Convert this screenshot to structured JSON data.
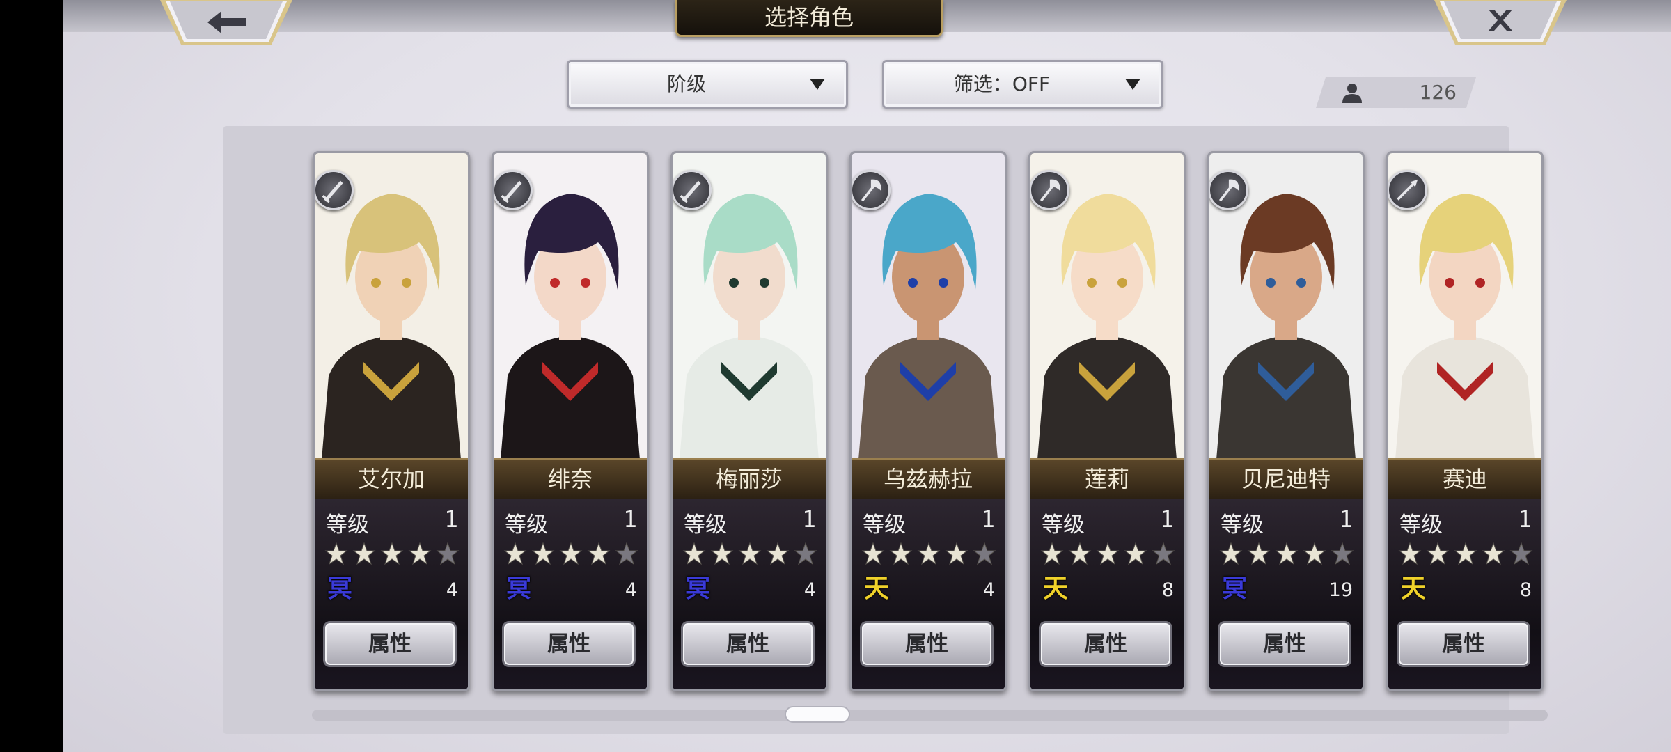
{
  "header": {
    "title": "选择角色",
    "back_icon": "arrow-left-icon",
    "close_icon": "close-icon"
  },
  "filters": {
    "sort_label": "阶级",
    "filter_label": "筛选：OFF"
  },
  "character_count": "126",
  "cards": [
    {
      "name": "艾尔加",
      "level_label": "等级",
      "level": "1",
      "stars": 4,
      "element": "冥",
      "element_color": "#3a3ad8",
      "count": "4",
      "button": "属性",
      "weapon_icon": "sword-icon",
      "palette": {
        "hair": "#d8c27a",
        "bg": "#f3efe6",
        "outfit": "#2b2420",
        "skin": "#f0d2b6",
        "accent": "#c9a23c"
      }
    },
    {
      "name": "绯奈",
      "level_label": "等级",
      "level": "1",
      "stars": 4,
      "element": "冥",
      "element_color": "#3a3ad8",
      "count": "4",
      "button": "属性",
      "weapon_icon": "sword-icon",
      "palette": {
        "hair": "#2a1f3e",
        "bg": "#f4f1f3",
        "outfit": "#1c1618",
        "skin": "#f3d8c8",
        "accent": "#c02a2a"
      }
    },
    {
      "name": "梅丽莎",
      "level_label": "等级",
      "level": "1",
      "stars": 4,
      "element": "冥",
      "element_color": "#3a3ad8",
      "count": "4",
      "button": "属性",
      "weapon_icon": "sword-icon",
      "palette": {
        "hair": "#a9dcc7",
        "bg": "#f3f5f2",
        "outfit": "#e6ebe6",
        "skin": "#f1dccd",
        "accent": "#1f3a30"
      }
    },
    {
      "name": "乌兹赫拉",
      "level_label": "等级",
      "level": "1",
      "stars": 4,
      "element": "天",
      "element_color": "#f0d22a",
      "count": "4",
      "button": "属性",
      "weapon_icon": "axe-icon",
      "palette": {
        "hair": "#4aa7c9",
        "bg": "#e9e6ef",
        "outfit": "#6a5a4e",
        "skin": "#c99572",
        "accent": "#1e3fa8"
      }
    },
    {
      "name": "莲莉",
      "level_label": "等级",
      "level": "1",
      "stars": 4,
      "element": "天",
      "element_color": "#f0d22a",
      "count": "8",
      "button": "属性",
      "weapon_icon": "axe-icon",
      "palette": {
        "hair": "#f0dc9c",
        "bg": "#f5f2ea",
        "outfit": "#2f2a28",
        "skin": "#f6dcc8",
        "accent": "#c9a23c"
      }
    },
    {
      "name": "贝尼迪特",
      "level_label": "等级",
      "level": "1",
      "stars": 4,
      "element": "冥",
      "element_color": "#3a3ad8",
      "count": "19",
      "button": "属性",
      "weapon_icon": "axe-icon",
      "palette": {
        "hair": "#6b3a24",
        "bg": "#eeeeee",
        "outfit": "#3a3632",
        "skin": "#d9a888",
        "accent": "#2f5d9a"
      }
    },
    {
      "name": "赛迪",
      "level_label": "等级",
      "level": "1",
      "stars": 4,
      "element": "天",
      "element_color": "#f0d22a",
      "count": "8",
      "button": "属性",
      "weapon_icon": "spear-icon",
      "palette": {
        "hair": "#e6d27a",
        "bg": "#f6f4ef",
        "outfit": "#e8e4dc",
        "skin": "#f3d6c2",
        "accent": "#b02424"
      }
    }
  ]
}
